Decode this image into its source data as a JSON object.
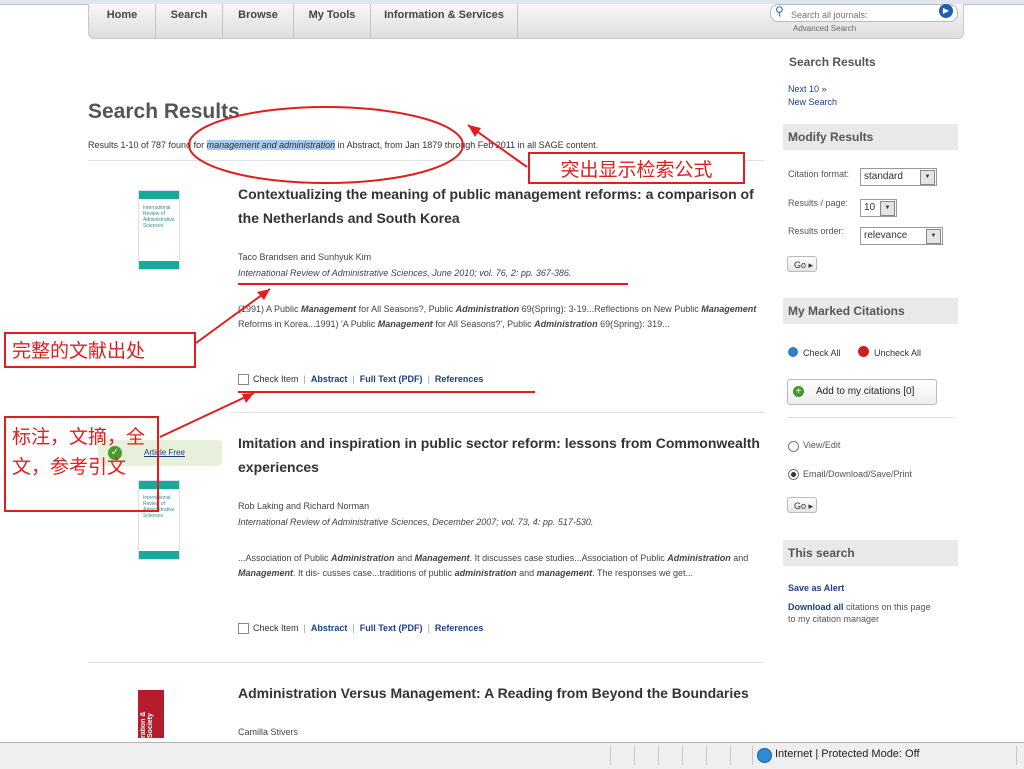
{
  "nav": {
    "tabs": [
      "Home",
      "Search",
      "Browse",
      "My Tools",
      "Information & Services"
    ],
    "search_placeholder": "Search all journals:",
    "advanced_search": "Advanced Search"
  },
  "main": {
    "title": "Search Results",
    "summary_prefix": "Results 1-10 of 787 found for ",
    "summary_query": "management and administration",
    "summary_suffix": " in Abstract, from Jan 1879 through Feb 2011 in all SAGE content.",
    "results": [
      {
        "title": "Contextualizing the meaning of public management reforms: a comparison of the Netherlands and South Korea",
        "authors": "Taco Brandsen and Sunhyuk Kim",
        "source": "International Review of Administrative Sciences, June 2010; vol. 76, 2: pp. 367-386.",
        "snippet": "(1991) A Public Management for All Seasons?, Public Administration 69(Spring): 3-19...Reflections on New Public Management Reforms in Korea...1991) 'A Public Management for All Seasons?', Public Administration 69(Spring): 319...",
        "thumb_text": "International Review of Administrative Sciences"
      },
      {
        "title": "Imitation and inspiration in public sector reform: lessons from Commonwealth experiences",
        "authors": "Rob Laking and Richard Norman",
        "source": "International Review of Administrative Sciences, December 2007; vol. 73, 4: pp. 517-530.",
        "snippet": "...Association of Public Administration and Management. It discusses case studies...Association of Public Administration and Management. It dis- cusses case...traditions of public administration and management. The responses we get...",
        "thumb_text": "International Review of Administrative Sciences",
        "badge": "Article Free"
      },
      {
        "title": "Administration Versus Management: A Reading from Beyond the Boundaries",
        "authors": "Camilla Stivers",
        "thumb_text": "ration & Society"
      }
    ],
    "actions": {
      "check_item": "Check Item",
      "abstract": "Abstract",
      "full_text": "Full Text (PDF)",
      "references": "References"
    }
  },
  "sidebar": {
    "search_results_heading": "Search Results",
    "next_10": "Next 10 »",
    "new_search": "New Search",
    "modify_heading": "Modify Results",
    "citation_format_label": "Citation format:",
    "citation_format_value": "standard",
    "results_per_page_label": "Results / page:",
    "results_per_page_value": "10",
    "results_order_label": "Results order:",
    "results_order_value": "relevance",
    "go": "Go",
    "marked_heading": "My Marked Citations",
    "check_all": "Check All",
    "uncheck_all": "Uncheck All",
    "add_to_citations": "Add to my citations [0]",
    "view_edit": "View/Edit",
    "email_download": "Email/Download/Save/Print",
    "this_search_heading": "This search",
    "save_alert": "Save as Alert",
    "download_all": "Download all",
    "download_all_rest": " citations on this page to my citation manager"
  },
  "annotations": {
    "highlight_formula": "突出显示检索公式",
    "full_source": "完整的文献出处",
    "tags_note": "标注，文摘，全文，参考引文"
  },
  "statusbar": {
    "zone": "Internet | Protected Mode: Off"
  },
  "colors": {
    "annotation_red": "#e01e1e",
    "link_blue": "#1c3f83",
    "query_highlight": "#a6c9ec"
  }
}
